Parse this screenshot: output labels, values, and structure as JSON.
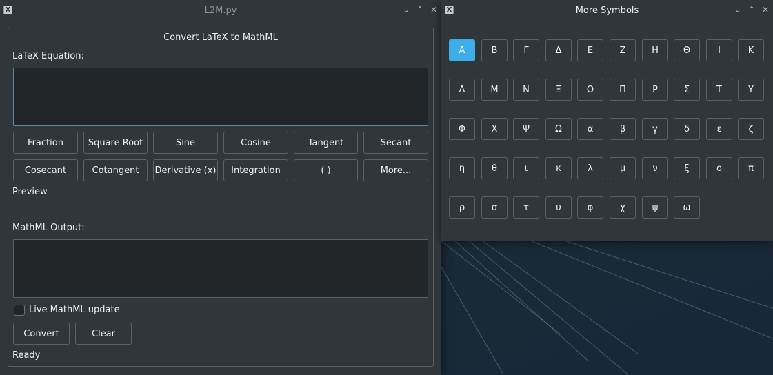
{
  "main_window": {
    "title": "L2M.py",
    "controls": {
      "minimize": "⌄",
      "maximize": "⌃",
      "close": "✕"
    },
    "group_title": "Convert LaTeX to MathML",
    "latex_label": "LaTeX Equation:",
    "latex_value": "",
    "buttons_row1": [
      "Fraction",
      "Square Root",
      "Sine",
      "Cosine",
      "Tangent",
      "Secant"
    ],
    "buttons_row2": [
      "Cosecant",
      "Cotangent",
      "Derivative (x)",
      "Integration",
      "( )",
      "More..."
    ],
    "preview_label": "Preview",
    "output_label": "MathML Output:",
    "output_value": "",
    "live_update_label": "Live MathML update",
    "live_update_checked": false,
    "convert_label": "Convert",
    "clear_label": "Clear",
    "status": "Ready"
  },
  "symbols_window": {
    "title": "More Symbols",
    "controls": {
      "minimize": "⌄",
      "maximize": "⌃",
      "close": "✕"
    },
    "accent_color": "#3daee9",
    "selected_symbol": "Α",
    "symbols": [
      [
        "Α",
        "Β",
        "Γ",
        "Δ",
        "Ε",
        "Ζ",
        "Η",
        "Θ",
        "Ι",
        "Κ"
      ],
      [
        "Λ",
        "Μ",
        "Ν",
        "Ξ",
        "Ο",
        "Π",
        "Ρ",
        "Σ",
        "Τ",
        "Υ"
      ],
      [
        "Φ",
        "Χ",
        "Ψ",
        "Ω",
        "α",
        "β",
        "γ",
        "δ",
        "ε",
        "ζ"
      ],
      [
        "η",
        "θ",
        "ι",
        "κ",
        "λ",
        "μ",
        "ν",
        "ξ",
        "ο",
        "π"
      ],
      [
        "ρ",
        "σ",
        "τ",
        "υ",
        "φ",
        "χ",
        "ψ",
        "ω"
      ]
    ]
  }
}
